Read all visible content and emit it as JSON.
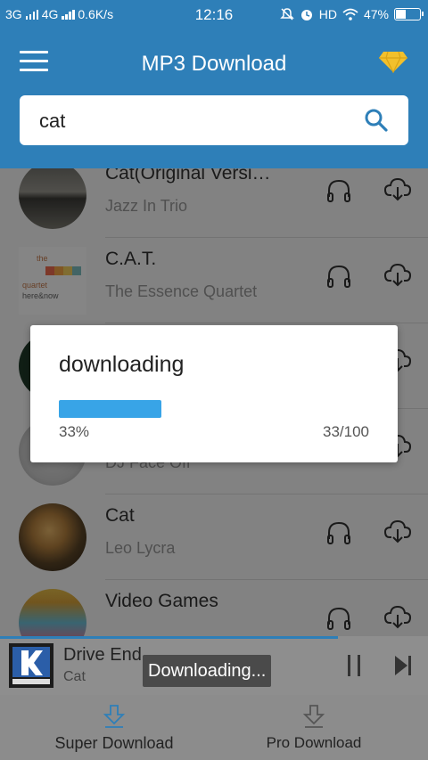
{
  "status_bar": {
    "network1": "3G",
    "network2": "4G",
    "speed": "0.6K/s",
    "time": "12:16",
    "hd": "HD",
    "battery": "47%",
    "battery_level": 0.47
  },
  "header": {
    "title": "MP3 Download",
    "search_value": "cat"
  },
  "songs": [
    {
      "title": "Cat(Original Versi…",
      "artist": "Jazz In Trio"
    },
    {
      "title": "C.A.T.",
      "artist": "The Essence Quartet"
    },
    {
      "title": "",
      "artist": ""
    },
    {
      "title": "",
      "artist": "DJ Face Off"
    },
    {
      "title": "Cat",
      "artist": "Leo Lycra"
    },
    {
      "title": "Video Games",
      "artist": ""
    }
  ],
  "dialog": {
    "title": "downloading",
    "progress": 0.33,
    "percent_label": "33%",
    "count_label": "33/100"
  },
  "player": {
    "title": "Drive End",
    "artist": "Cat",
    "progress": 0.79,
    "toast": "Downloading..."
  },
  "bottom_tabs": [
    {
      "label": "Super Download"
    },
    {
      "label": "Pro Download"
    }
  ],
  "colors": {
    "primary": "#2e7fb8",
    "progress": "#38a4e7",
    "gem": "#f2c02c"
  }
}
